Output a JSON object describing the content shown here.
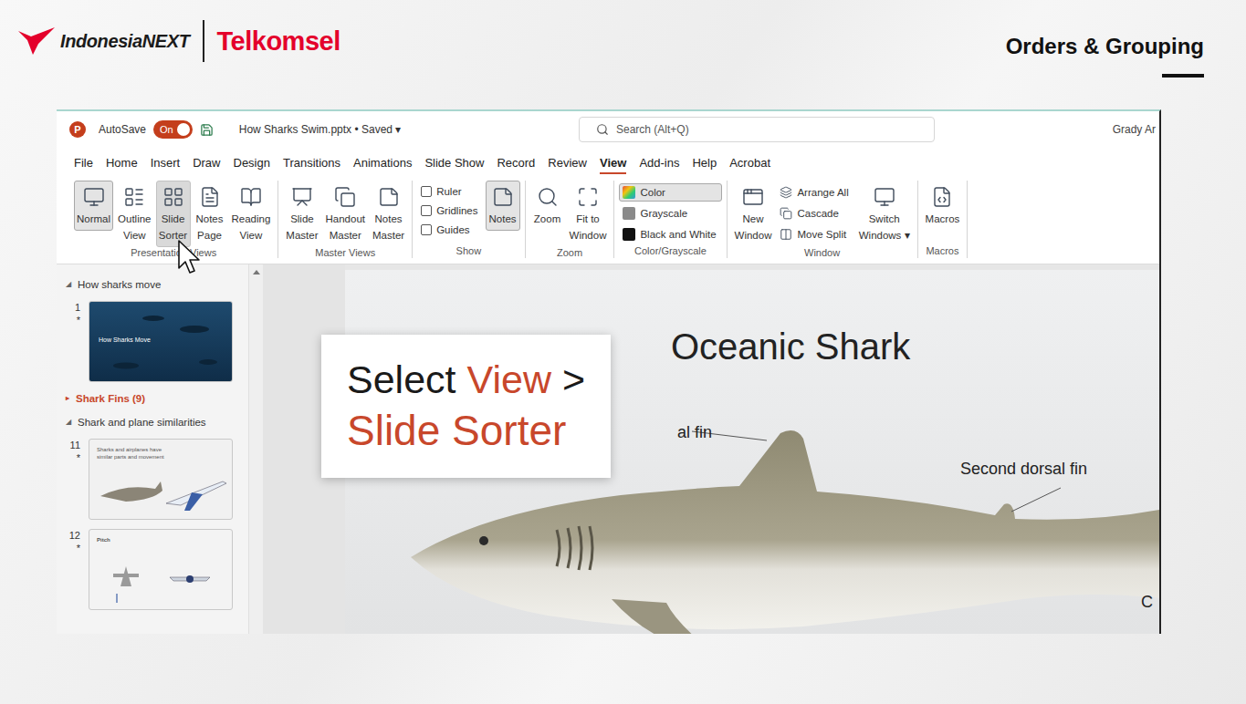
{
  "header": {
    "brand": "IndonesiaNEXT",
    "partner": "Telkomsel",
    "title": "Orders & Grouping"
  },
  "app": {
    "logo": "P",
    "autosave": {
      "label": "AutoSave",
      "state": "On",
      "on": true
    },
    "file": "How Sharks Swim.pptx • Saved",
    "file_caret": "▾",
    "search": {
      "placeholder": "Search (Alt+Q)"
    },
    "user": "Grady Ar",
    "menu_tabs": [
      {
        "label": "File",
        "selected": false
      },
      {
        "label": "Home",
        "selected": false
      },
      {
        "label": "Insert",
        "selected": false
      },
      {
        "label": "Draw",
        "selected": false
      },
      {
        "label": "Design",
        "selected": false
      },
      {
        "label": "Transitions",
        "selected": false
      },
      {
        "label": "Animations",
        "selected": false
      },
      {
        "label": "Slide Show",
        "selected": false
      },
      {
        "label": "Record",
        "selected": false
      },
      {
        "label": "Review",
        "selected": false
      },
      {
        "label": "View",
        "selected": true
      },
      {
        "label": "Add-ins",
        "selected": false
      },
      {
        "label": "Help",
        "selected": false
      },
      {
        "label": "Acrobat",
        "selected": false
      }
    ],
    "ribbon": [
      {
        "label": "Presentation Views",
        "columns": [
          [
            {
              "kind": "large",
              "lines": [
                "Normal"
              ],
              "selected": true,
              "hovered": false
            }
          ],
          [
            {
              "kind": "large",
              "lines": [
                "Outline",
                "View"
              ],
              "selected": false,
              "hovered": false
            }
          ],
          [
            {
              "kind": "large",
              "lines": [
                "Slide",
                "Sorter"
              ],
              "selected": false,
              "hovered": true
            }
          ],
          [
            {
              "kind": "large",
              "lines": [
                "Notes",
                "Page"
              ],
              "selected": false,
              "hovered": false
            }
          ],
          [
            {
              "kind": "large",
              "lines": [
                "Reading",
                "View"
              ],
              "selected": false,
              "hovered": false
            }
          ]
        ]
      },
      {
        "label": "Master Views",
        "columns": [
          [
            {
              "kind": "large",
              "lines": [
                "Slide",
                "Master"
              ],
              "selected": false,
              "hovered": false
            }
          ],
          [
            {
              "kind": "large",
              "lines": [
                "Handout",
                "Master"
              ],
              "selected": false,
              "hovered": false
            }
          ],
          [
            {
              "kind": "large",
              "lines": [
                "Notes",
                "Master"
              ],
              "selected": false,
              "hovered": false
            }
          ]
        ]
      },
      {
        "label": "Show",
        "columns": [
          [
            {
              "kind": "check",
              "lines": [
                "Ruler"
              ],
              "checked": false
            },
            {
              "kind": "check",
              "lines": [
                "Gridlines"
              ],
              "checked": false
            },
            {
              "kind": "check",
              "lines": [
                "Guides"
              ],
              "checked": false
            }
          ],
          [
            {
              "kind": "large",
              "lines": [
                "Notes"
              ],
              "selected": true,
              "hovered": false
            }
          ]
        ]
      },
      {
        "label": "Zoom",
        "columns": [
          [
            {
              "kind": "large",
              "lines": [
                "Zoom"
              ],
              "selected": false,
              "hovered": false
            }
          ],
          [
            {
              "kind": "large",
              "lines": [
                "Fit to",
                "Window"
              ],
              "selected": false,
              "hovered": false
            }
          ]
        ]
      },
      {
        "label": "Color/Grayscale",
        "columns": [
          [
            {
              "kind": "small",
              "lines": [
                "Color"
              ],
              "selected": true
            },
            {
              "kind": "small",
              "lines": [
                "Grayscale"
              ],
              "selected": false
            },
            {
              "kind": "small",
              "lines": [
                "Black and White"
              ],
              "selected": false
            }
          ]
        ]
      },
      {
        "label": "Window",
        "columns": [
          [
            {
              "kind": "large",
              "lines": [
                "New",
                "Window"
              ],
              "selected": false,
              "hovered": false
            }
          ],
          [
            {
              "kind": "small",
              "lines": [
                "Arrange All"
              ],
              "selected": false
            },
            {
              "kind": "small",
              "lines": [
                "Cascade"
              ],
              "selected": false
            },
            {
              "kind": "small",
              "lines": [
                "Move Split"
              ],
              "selected": false
            }
          ],
          [
            {
              "kind": "large",
              "lines": [
                "Switch",
                "Windows ▾"
              ],
              "selected": false,
              "hovered": false
            }
          ]
        ]
      },
      {
        "label": "Macros",
        "columns": [
          [
            {
              "kind": "large",
              "lines": [
                "Macros"
              ],
              "selected": false,
              "hovered": false
            }
          ]
        ]
      }
    ]
  },
  "thumbnails": [
    {
      "kind": "section",
      "arrow": "◢",
      "label": "How sharks move",
      "expanded": true,
      "selected": false
    },
    {
      "kind": "photo-slide",
      "number": "1",
      "mark": "*",
      "texts": [
        "How Sharks Move"
      ]
    },
    {
      "kind": "section",
      "arrow": "▸",
      "label": "Shark Fins (9)",
      "expanded": false,
      "selected": true
    },
    {
      "kind": "section",
      "arrow": "◢",
      "label": "Shark and plane similarities",
      "expanded": true,
      "selected": false
    },
    {
      "kind": "compare-slide",
      "number": "11",
      "mark": "*",
      "texts": [
        "Sharks and airplanes have similar parts and movement"
      ]
    },
    {
      "kind": "pitch-slide",
      "number": "12",
      "mark": "*",
      "texts": [
        "Pitch"
      ]
    }
  ],
  "slide": {
    "title": "Oceanic Shark",
    "labels": [
      "al fin",
      "Second dorsal fin",
      "C"
    ]
  },
  "callout": {
    "lines": [
      [
        {
          "text": "Select",
          "accent": false
        },
        {
          "text": "View",
          "accent": true
        },
        {
          "text": ">",
          "accent": false
        }
      ],
      [
        {
          "text": "Slide Sorter",
          "accent": true
        }
      ]
    ]
  },
  "cursor": {
    "visible": true
  }
}
